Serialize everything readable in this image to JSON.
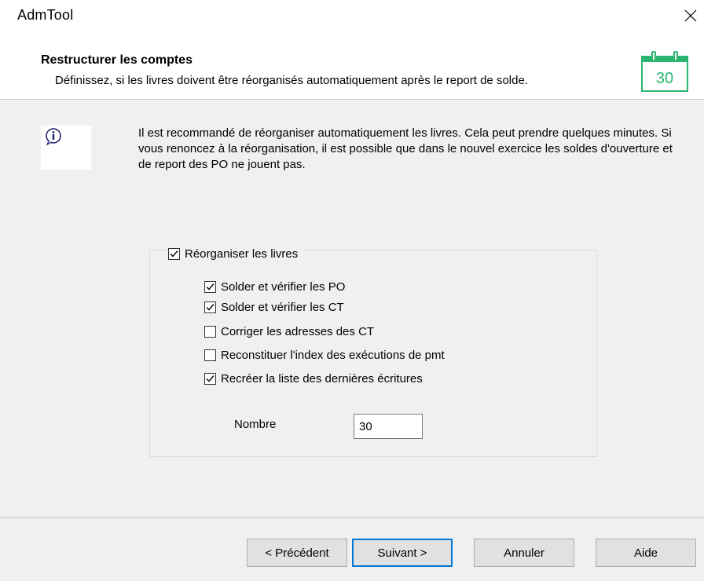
{
  "window": {
    "title": "AdmTool"
  },
  "header": {
    "title": "Restructurer les comptes",
    "description": "Définissez, si les livres doivent être réorganisés automatiquement après le report de solde.",
    "calendar_icon": {
      "name": "calendar-icon",
      "number": "30",
      "color": "#2bb673"
    }
  },
  "info": {
    "icon": "info-icon",
    "text": "Il est recommandé de réorganiser automatiquement les livres. Cela peut prendre quelques minutes. Si vous renoncez à la réorganisation, il est possible que dans le nouvel exercice les soldes d'ouverture et de report des PO ne jouent pas."
  },
  "group": {
    "label": "Réorganiser les livres",
    "checked": true,
    "options": [
      {
        "label": "Solder et vérifier les PO",
        "checked": true
      },
      {
        "label": "Solder et vérifier les CT",
        "checked": true
      },
      {
        "label": "Corriger les adresses des CT",
        "checked": false
      },
      {
        "label": "Reconstituer l'index des exécutions de pmt",
        "checked": false
      },
      {
        "label": "Recréer la liste des dernières écritures",
        "checked": true
      }
    ],
    "nombre": {
      "label": "Nombre",
      "value": "30"
    }
  },
  "buttons": {
    "previous": "< Précédent",
    "next": "Suivant >",
    "cancel": "Annuler",
    "help": "Aide"
  }
}
